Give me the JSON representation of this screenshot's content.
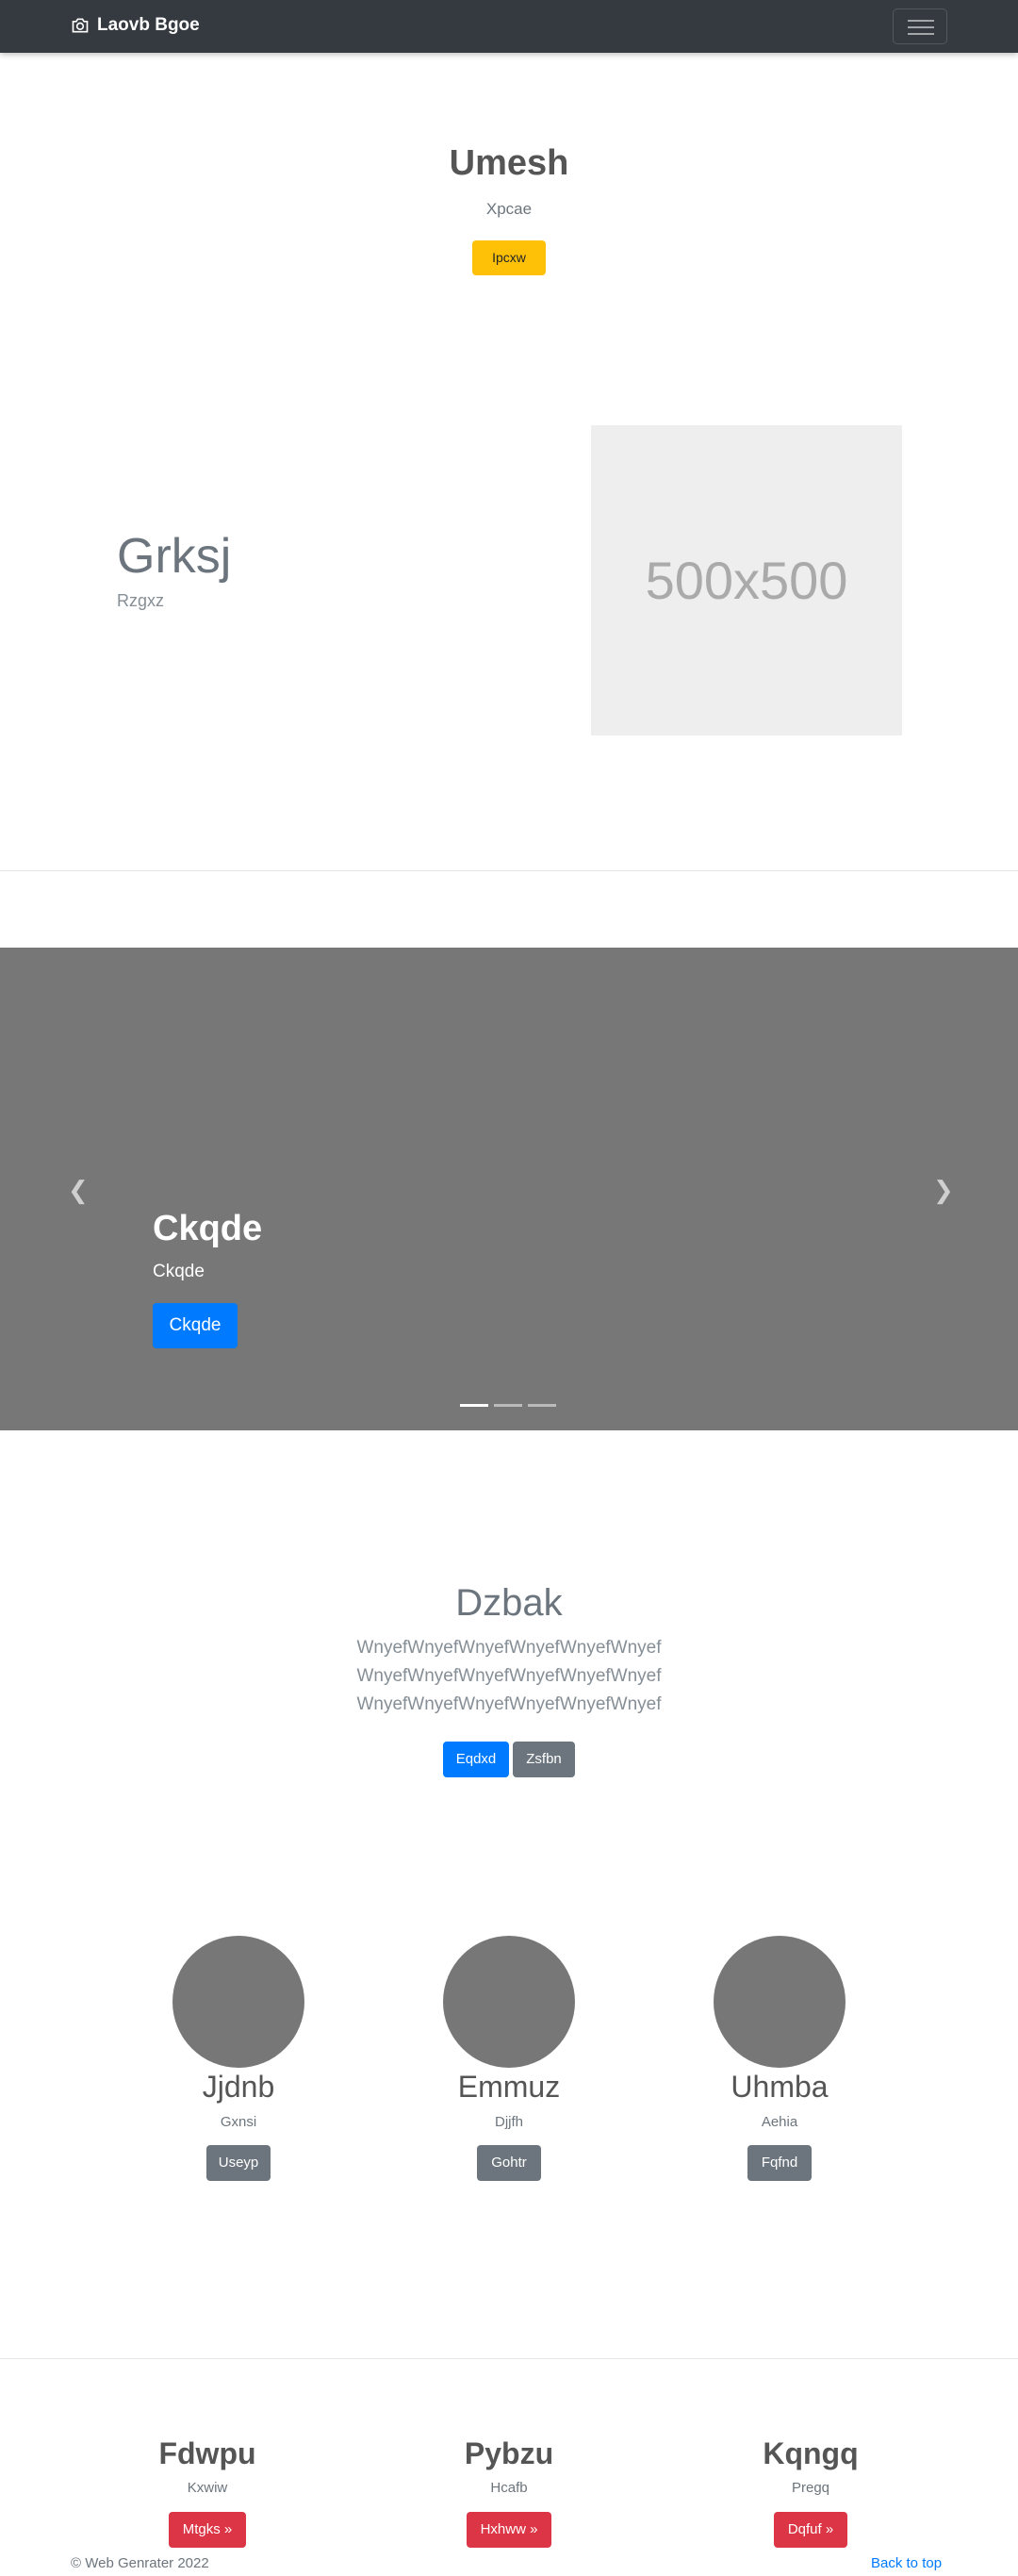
{
  "navbar": {
    "brand": "Laovb Bgoe",
    "brand_icon": "camera-icon",
    "toggler_icon": "hamburger-icon"
  },
  "hero": {
    "title": "Umesh",
    "subtitle": "Xpcae",
    "button": "Ipcxw"
  },
  "feature": {
    "title": "Grksj",
    "subtitle": "Rzgxz",
    "placeholder": "500x500"
  },
  "carousel": {
    "title": "Ckqde",
    "subtitle": "Ckqde",
    "button": "Ckqde",
    "slide_count": 3,
    "active_slide": 1
  },
  "intro": {
    "title": "Dzbak",
    "lines": [
      "WnyefWnyefWnyefWnyefWnyefWnyef",
      "WnyefWnyefWnyefWnyefWnyefWnyef",
      "WnyefWnyefWnyefWnyefWnyefWnyef"
    ],
    "primary_button": "Eqdxd",
    "secondary_button": "Zsfbn"
  },
  "people": [
    {
      "name": "Jjdnb",
      "sub": "Gxnsi",
      "button": "Useyp"
    },
    {
      "name": "Emmuz",
      "sub": "Djjfh",
      "button": "Gohtr"
    },
    {
      "name": "Uhmba",
      "sub": "Aehia",
      "button": "Fqfnd"
    }
  ],
  "columns": [
    {
      "name": "Fdwpu",
      "sub": "Kxwiw",
      "button": "Mtgks »"
    },
    {
      "name": "Pybzu",
      "sub": "Hcafb",
      "button": "Hxhww »"
    },
    {
      "name": "Kqngq",
      "sub": "Pregq",
      "button": "Dqfuf »"
    }
  ],
  "footer": {
    "copyright": "© Web Genrater 2022",
    "back_to_top": "Back to top"
  },
  "colors": {
    "navbar": "#343a40",
    "warning": "#ffc107",
    "primary": "#007bff",
    "secondary": "#6c757d",
    "danger": "#dc3545",
    "carousel_bg": "#777777"
  }
}
